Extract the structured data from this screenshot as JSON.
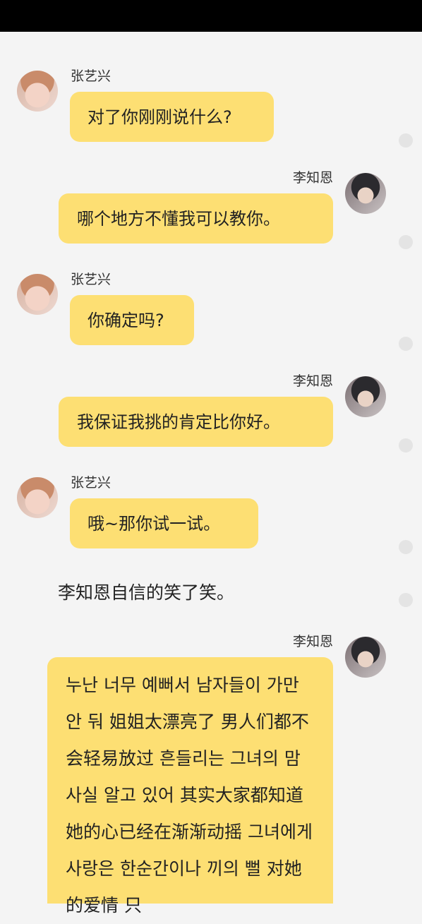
{
  "messages": [
    {
      "sender": "张艺兴",
      "text": "对了你刚刚说什么?"
    },
    {
      "sender": "李知恩",
      "text": "哪个地方不懂我可以教你。"
    },
    {
      "sender": "张艺兴",
      "text": "你确定吗?"
    },
    {
      "sender": "李知恩",
      "text": "我保证我挑的肯定比你好。"
    },
    {
      "sender": "张艺兴",
      "text": "哦~那你试一试。"
    }
  ],
  "narration": "李知恩自信的笑了笑。",
  "last_message": {
    "sender": "李知恩",
    "text": "누난 너무 예뻐서 남자들이 가만 안 둬 姐姐太漂亮了 男人们都不会轻易放过 흔들리는 그녀의 맘 사실 알고 있어 其实大家都知道 她的心已经在渐渐动摇 그녀에게 사랑은 한순간이나 끼의 뻘 对她的爱情 只"
  }
}
